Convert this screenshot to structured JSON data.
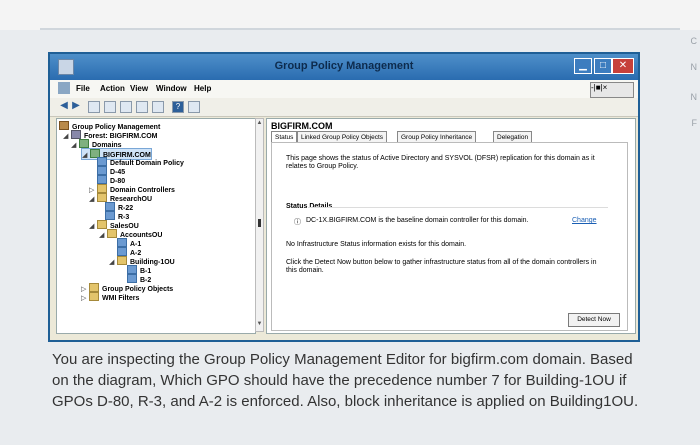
{
  "window": {
    "title": "Group Policy Management",
    "min_glyph": "▁",
    "max_glyph": "□",
    "close_glyph": "✕"
  },
  "menu": {
    "items": [
      "File",
      "Action",
      "View",
      "Window",
      "Help"
    ],
    "child_controls": "-|■|×"
  },
  "toolbar": {
    "buttons": [
      "back-arrow",
      "forward-arrow",
      "folder",
      "list",
      "properties",
      "refresh",
      "export",
      "help",
      "console"
    ],
    "help_glyph": "?"
  },
  "tree": {
    "root": "Group Policy Management",
    "forest": "Forest: BIGFIRM.COM",
    "domains": "Domains",
    "domain": "BIGFIRM.COM",
    "items": [
      "Default Domain Policy",
      "D-45",
      "D-80",
      "Domain Controllers",
      "ResearchOU",
      "R-22",
      "R-3",
      "SalesOU",
      "AccountsOU",
      "A-1",
      "A-2",
      "Building-1OU",
      "B-1",
      "B-2",
      "Group Policy Objects",
      "WMI Filters"
    ],
    "exp_open": "◢",
    "exp_closed": "▷"
  },
  "right_pane": {
    "title": "BIGFIRM.COM",
    "tabs": [
      "Status",
      "Linked Group Policy Objects",
      "Group Policy Inheritance",
      "Delegation"
    ],
    "intro": "This page shows the status of Active Directory and SYSVOL (DFSR) replication for this domain as it",
    "intro2": "relates to Group Policy.",
    "status_details_label": "Status Details",
    "baseline_text": "DC-1X.BIGFIRM.COM is the baseline domain controller for this domain.",
    "change_link": "Change",
    "no_info": "No Infrastructure Status information exists for this domain.",
    "detect_hint1": "Click the Detect Now button below to gather infrastructure status from all of the domain controllers in",
    "detect_hint2": "this domain.",
    "detect_button": "Detect Now"
  },
  "scroll": {
    "up": "▲",
    "down": "▼",
    "mid": "■"
  },
  "question": {
    "line1": "You are inspecting the Group Policy Management Editor for bigfirm.com domain. Based",
    "line2": "on the diagram, Which GPO should have the precedence number 7 for Building-1OU if",
    "line3": "GPOs D-80, R-3, and A-2 is enforced. Also, block inheritance is applied on Building1OU."
  },
  "edge_letters": [
    "C",
    "N",
    "N",
    "F"
  ]
}
